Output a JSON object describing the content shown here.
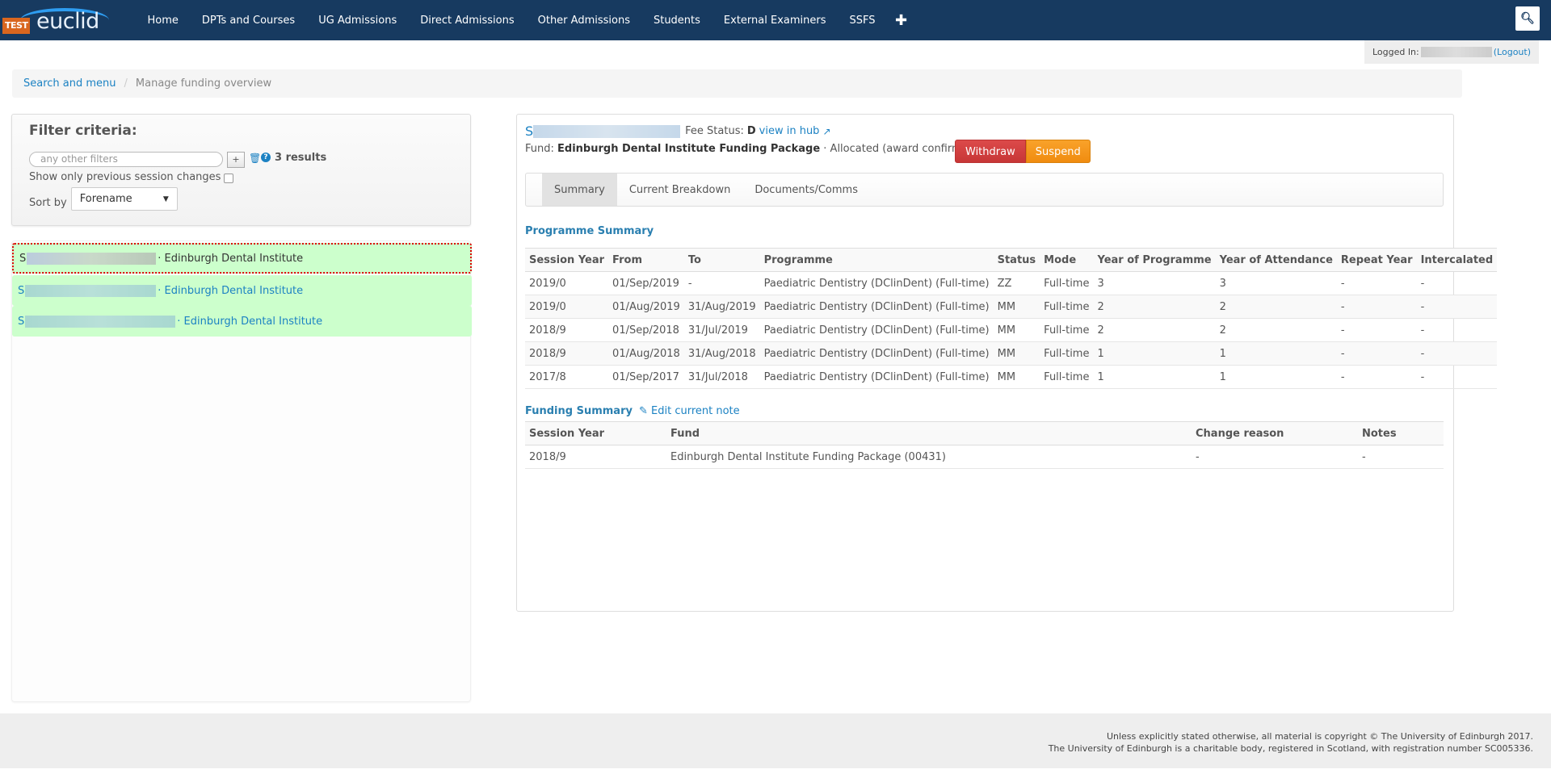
{
  "app": {
    "logo_badge": "TEST",
    "logo_word": "euclid"
  },
  "nav": {
    "items": [
      "Home",
      "DPTs and Courses",
      "UG Admissions",
      "Direct Admissions",
      "Other Admissions",
      "Students",
      "External Examiners",
      "SSFS"
    ],
    "plus_icon": "plus-icon",
    "search_icon": "search-icon"
  },
  "login": {
    "label": "Logged In:",
    "logout": "(Logout)"
  },
  "breadcrumb": {
    "root": "Search and menu",
    "separator": "/",
    "current": "Manage funding overview"
  },
  "filter": {
    "title": "Filter criteria:",
    "placeholder": "any other filters",
    "add_label": "+",
    "results": "3 results",
    "prev_session_label": "Show only previous session changes",
    "sort_label": "Sort by",
    "sort_value": "Forename"
  },
  "results_list": [
    {
      "prefix": "S",
      "institute": "· Edinburgh Dental Institute",
      "selected": true
    },
    {
      "prefix": "S",
      "institute": "· Edinburgh Dental Institute",
      "selected": false
    },
    {
      "prefix": "S",
      "institute": "· Edinburgh Dental Institute",
      "selected": false
    }
  ],
  "detail": {
    "student_prefix": "S",
    "fee_status_label": "Fee Status:",
    "fee_status_value": "D",
    "view_hub": "view in hub",
    "fund_label": "Fund:",
    "fund_name": "Edinburgh Dental Institute Funding Package",
    "fund_status": "· Allocated (award confirmed)",
    "withdraw": "Withdraw",
    "suspend": "Suspend",
    "tabs": [
      "Summary",
      "Current Breakdown",
      "Documents/Comms"
    ],
    "active_tab": "Summary"
  },
  "programme_summary": {
    "title": "Programme Summary",
    "columns": [
      "Session Year",
      "From",
      "To",
      "Programme",
      "Status",
      "Mode",
      "Year of Programme",
      "Year of Attendance",
      "Repeat Year",
      "Intercalated"
    ],
    "rows": [
      [
        "2019/0",
        "01/Sep/2019",
        "-",
        "Paediatric Dentistry (DClinDent) (Full-time)",
        "ZZ",
        "Full-time",
        "3",
        "3",
        "-",
        "-"
      ],
      [
        "2019/0",
        "01/Aug/2019",
        "31/Aug/2019",
        "Paediatric Dentistry (DClinDent) (Full-time)",
        "MM",
        "Full-time",
        "2",
        "2",
        "-",
        "-"
      ],
      [
        "2018/9",
        "01/Sep/2018",
        "31/Jul/2019",
        "Paediatric Dentistry (DClinDent) (Full-time)",
        "MM",
        "Full-time",
        "2",
        "2",
        "-",
        "-"
      ],
      [
        "2018/9",
        "01/Aug/2018",
        "31/Aug/2018",
        "Paediatric Dentistry (DClinDent) (Full-time)",
        "MM",
        "Full-time",
        "1",
        "1",
        "-",
        "-"
      ],
      [
        "2017/8",
        "01/Sep/2017",
        "31/Jul/2018",
        "Paediatric Dentistry (DClinDent) (Full-time)",
        "MM",
        "Full-time",
        "1",
        "1",
        "-",
        "-"
      ]
    ]
  },
  "funding_summary": {
    "title": "Funding Summary",
    "edit_note": "Edit current note",
    "columns": [
      "Session Year",
      "Fund",
      "Change reason",
      "Notes"
    ],
    "rows": [
      [
        "2018/9",
        "Edinburgh Dental Institute Funding Package (00431)",
        "-",
        "-"
      ]
    ]
  },
  "footer": {
    "line1": "Unless explicitly stated otherwise, all material is copyright © The University of Edinburgh 2017.",
    "line2": "The University of Edinburgh is a charitable body, registered in Scotland, with registration number SC005336."
  },
  "colors": {
    "navbar": "#173a60",
    "link": "#1c82c3",
    "row_highlight": "#ccffcc",
    "withdraw": "#d43f3f",
    "suspend": "#f7941d",
    "logo_badge": "#d9661f"
  }
}
